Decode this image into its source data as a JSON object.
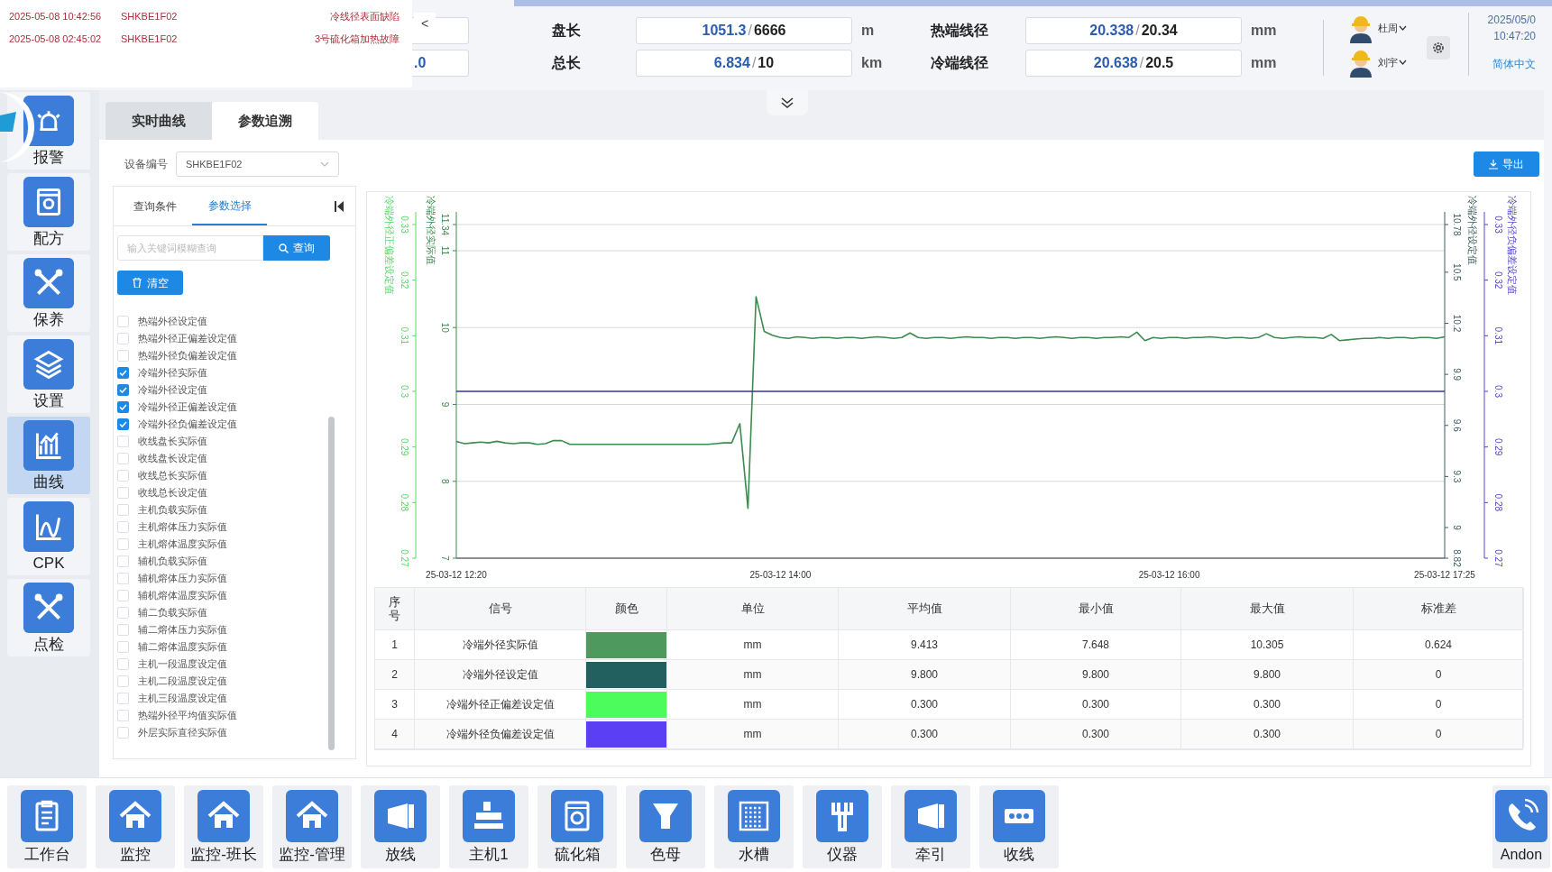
{
  "alerts": [
    {
      "time": "2025-05-08 10:42:56",
      "device": "SHKBE1F02",
      "message": "冷线径表面缺陷"
    },
    {
      "time": "2025-05-08 02:45:02",
      "device": "SHKBE1F02",
      "message": "3号硫化箱加热故障"
    }
  ],
  "alert_collapse": "<",
  "cut_field": {
    "value": ".0"
  },
  "metrics": [
    {
      "label": "盘长",
      "actual": "1051.3",
      "target": "6666",
      "unit": "m",
      "separator": "/"
    },
    {
      "label": "热端线径",
      "actual": "20.338",
      "target": "20.34",
      "unit": "mm",
      "separator": "/"
    },
    {
      "label": "总长",
      "actual": "6.834",
      "target": "10",
      "unit": "km",
      "separator": "/"
    },
    {
      "label": "冷端线径",
      "actual": "20.638",
      "target": "20.5",
      "unit": "mm",
      "separator": "/"
    }
  ],
  "users": [
    {
      "name": "杜周"
    },
    {
      "name": "刘宇"
    }
  ],
  "datetime": {
    "date": "2025/05/0",
    "time": "10:47:20"
  },
  "language": "简体中文",
  "sidebar": {
    "items": [
      {
        "label": "报警",
        "selected": false
      },
      {
        "label": "配方",
        "selected": false
      },
      {
        "label": "保养",
        "selected": false
      },
      {
        "label": "设置",
        "selected": false
      },
      {
        "label": "曲线",
        "selected": true
      },
      {
        "label": "CPK",
        "selected": false
      },
      {
        "label": "点检",
        "selected": false
      }
    ]
  },
  "tabs": [
    {
      "label": "实时曲线",
      "selected": false
    },
    {
      "label": "参数追溯",
      "selected": true
    }
  ],
  "device": {
    "label": "设备编号",
    "value": "SHKBE1F02"
  },
  "export_button": "导出",
  "filter": {
    "tabs": [
      {
        "label": "查询条件",
        "selected": false
      },
      {
        "label": "参数选择",
        "selected": true
      }
    ],
    "search": {
      "placeholder": "输入关键词模糊查询",
      "button": "查询"
    },
    "clear_button": "清空",
    "params": [
      {
        "label": "热端外径设定值",
        "checked": false
      },
      {
        "label": "热端外径正偏差设定值",
        "checked": false
      },
      {
        "label": "热端外径负偏差设定值",
        "checked": false
      },
      {
        "label": "冷端外径实际值",
        "checked": true
      },
      {
        "label": "冷端外径设定值",
        "checked": true
      },
      {
        "label": "冷端外径正偏差设定值",
        "checked": true
      },
      {
        "label": "冷端外径负偏差设定值",
        "checked": true
      },
      {
        "label": "收线盘长实际值",
        "checked": false
      },
      {
        "label": "收线盘长设定值",
        "checked": false
      },
      {
        "label": "收线总长实际值",
        "checked": false
      },
      {
        "label": "收线总长设定值",
        "checked": false
      },
      {
        "label": "主机负载实际值",
        "checked": false
      },
      {
        "label": "主机熔体压力实际值",
        "checked": false
      },
      {
        "label": "主机熔体温度实际值",
        "checked": false
      },
      {
        "label": "辅机负载实际值",
        "checked": false
      },
      {
        "label": "辅机熔体压力实际值",
        "checked": false
      },
      {
        "label": "辅机熔体温度实际值",
        "checked": false
      },
      {
        "label": "辅二负载实际值",
        "checked": false
      },
      {
        "label": "辅二熔体压力实际值",
        "checked": false
      },
      {
        "label": "辅二熔体温度实际值",
        "checked": false
      },
      {
        "label": "主机一段温度设定值",
        "checked": false
      },
      {
        "label": "主机二段温度设定值",
        "checked": false
      },
      {
        "label": "主机三段温度设定值",
        "checked": false
      },
      {
        "label": "热端外径平均值实际值",
        "checked": false
      },
      {
        "label": "外层实际直径实际值",
        "checked": false
      }
    ]
  },
  "chart": {
    "extra_axes": [
      {
        "title": "冷端外径正偏差设定值",
        "ticks": [
          "0.27",
          "0.28",
          "0.29",
          "0.3",
          "0.31",
          "0.32",
          "0.33"
        ]
      }
    ],
    "chart_data": {
      "type": "line",
      "grid": true,
      "ylabel": "冷端外径实际值",
      "ylim": [
        7,
        11.34
      ],
      "yticks": [
        {
          "value": 7,
          "label": "7"
        },
        {
          "value": 8,
          "label": "8"
        },
        {
          "value": 9,
          "label": "9"
        },
        {
          "value": 10,
          "label": "10"
        },
        {
          "value": 11,
          "label": "11"
        },
        {
          "value": 11.34,
          "label": "11.34"
        }
      ],
      "y2label": "冷端外径设定值",
      "y2lim": [
        8.82,
        10.78
      ],
      "y2ticks": [
        {
          "value": 8.82,
          "label": "8.82"
        },
        {
          "value": 9,
          "label": "9"
        },
        {
          "value": 9.3,
          "label": "9.3"
        },
        {
          "value": 9.6,
          "label": "9.6"
        },
        {
          "value": 9.9,
          "label": "9.9"
        },
        {
          "value": 10.2,
          "label": "10.2"
        },
        {
          "value": 10.5,
          "label": "10.5"
        },
        {
          "value": 10.78,
          "label": "10.78"
        }
      ],
      "y3label": "冷端外径负偏差设定值",
      "y3lim": [
        0.27,
        0.33
      ],
      "y3ticks": [
        {
          "value": 0.27,
          "label": "0.27"
        },
        {
          "value": 0.28,
          "label": "0.28"
        },
        {
          "value": 0.29,
          "label": "0.29"
        },
        {
          "value": 0.3,
          "label": "0.3"
        },
        {
          "value": 0.31,
          "label": "0.31"
        },
        {
          "value": 0.32,
          "label": "0.32"
        },
        {
          "value": 0.33,
          "label": "0.33"
        }
      ],
      "categories": [
        "25-03-12 12:20",
        null,
        null,
        null,
        null,
        null,
        null,
        null,
        null,
        null,
        null,
        null,
        null,
        null,
        null,
        null,
        null,
        null,
        null,
        null,
        null,
        null,
        null,
        null,
        null,
        null,
        null,
        null,
        null,
        null,
        null,
        null,
        null,
        null,
        null,
        null,
        null,
        null,
        null,
        null,
        "25-03-12 14:00",
        null,
        null,
        null,
        null,
        null,
        null,
        null,
        null,
        null,
        null,
        null,
        null,
        null,
        null,
        null,
        null,
        null,
        null,
        null,
        null,
        null,
        null,
        null,
        null,
        null,
        null,
        null,
        null,
        null,
        null,
        null,
        null,
        null,
        null,
        null,
        null,
        null,
        null,
        null,
        null,
        null,
        null,
        null,
        null,
        null,
        null,
        null,
        "25-03-12 16:00",
        null,
        null,
        null,
        null,
        null,
        null,
        null,
        null,
        null,
        null,
        null,
        null,
        null,
        null,
        null,
        null,
        null,
        null,
        null,
        null,
        null,
        null,
        null,
        null,
        null,
        null,
        null,
        null,
        null,
        null,
        null,
        null,
        null,
        "25-03-12 17:25"
      ],
      "series": [
        {
          "color": "#3d8b4f",
          "values": [
            8.52,
            8.49,
            8.5,
            8.51,
            8.5,
            8.52,
            8.5,
            8.49,
            8.5,
            8.5,
            8.48,
            8.49,
            8.53,
            8.53,
            8.48,
            8.48,
            8.48,
            8.48,
            8.48,
            8.48,
            8.48,
            8.48,
            8.48,
            8.48,
            8.48,
            8.48,
            8.48,
            8.48,
            8.48,
            8.48,
            8.48,
            8.48,
            8.49,
            8.5,
            8.5,
            8.75,
            7.65,
            10.4,
            9.95,
            9.9,
            9.87,
            9.86,
            9.88,
            9.87,
            9.86,
            9.87,
            9.87,
            9.86,
            9.87,
            9.87,
            9.86,
            9.87,
            9.88,
            9.87,
            9.86,
            9.87,
            9.93,
            9.87,
            9.86,
            9.87,
            9.87,
            9.86,
            9.87,
            9.88,
            9.87,
            9.87,
            9.86,
            9.87,
            9.87,
            9.86,
            9.87,
            9.87,
            9.86,
            9.87,
            9.88,
            9.87,
            9.86,
            9.87,
            9.87,
            9.86,
            9.87,
            9.87,
            9.88,
            9.87,
            9.94,
            9.83,
            9.87,
            9.86,
            9.87,
            9.87,
            9.86,
            9.87,
            9.87,
            9.88,
            9.87,
            9.86,
            9.87,
            9.87,
            9.86,
            9.87,
            9.92,
            9.87,
            9.86,
            9.87,
            9.88,
            9.87,
            9.87,
            9.86,
            9.91,
            9.83,
            9.84,
            9.85,
            9.86,
            9.86,
            9.87,
            9.86,
            9.87,
            9.87,
            9.86,
            9.87,
            9.87,
            9.86,
            9.88
          ]
        },
        {
          "color": "#3b30a0",
          "axis": "y3",
          "values": [
            0.3,
            0.3,
            0.3,
            0.3,
            0.3,
            0.3,
            0.3,
            0.3,
            0.3,
            0.3,
            0.3,
            0.3,
            0.3,
            0.3,
            0.3,
            0.3,
            0.3,
            0.3,
            0.3,
            0.3,
            0.3,
            0.3,
            0.3,
            0.3,
            0.3,
            0.3,
            0.3,
            0.3,
            0.3,
            0.3,
            0.3,
            0.3,
            0.3,
            0.3,
            0.3,
            0.3,
            0.3,
            0.3,
            0.3,
            0.3,
            0.3,
            0.3,
            0.3,
            0.3,
            0.3,
            0.3,
            0.3,
            0.3,
            0.3,
            0.3,
            0.3,
            0.3,
            0.3,
            0.3,
            0.3,
            0.3,
            0.3,
            0.3,
            0.3,
            0.3,
            0.3,
            0.3,
            0.3,
            0.3,
            0.3,
            0.3,
            0.3,
            0.3,
            0.3,
            0.3,
            0.3,
            0.3,
            0.3,
            0.3,
            0.3,
            0.3,
            0.3,
            0.3,
            0.3,
            0.3,
            0.3,
            0.3,
            0.3,
            0.3,
            0.3,
            0.3,
            0.3,
            0.3,
            0.3,
            0.3,
            0.3,
            0.3,
            0.3,
            0.3,
            0.3,
            0.3,
            0.3,
            0.3,
            0.3,
            0.3,
            0.3,
            0.3,
            0.3,
            0.3,
            0.3,
            0.3,
            0.3,
            0.3,
            0.3,
            0.3,
            0.3,
            0.3,
            0.3,
            0.3,
            0.3,
            0.3,
            0.3,
            0.3,
            0.3,
            0.3,
            0.3,
            0.3,
            0.3
          ]
        }
      ]
    }
  },
  "table": {
    "columns": [
      "序号",
      "信号",
      "颜色",
      "单位",
      "平均值",
      "最小值",
      "最大值",
      "标准差"
    ],
    "rows": [
      {
        "index": "1",
        "signal": "冷端外径实际值",
        "color": "#4e9a5e",
        "unit": "mm",
        "mean": "9.413",
        "min": "7.648",
        "max": "10.305",
        "std": "0.624"
      },
      {
        "index": "2",
        "signal": "冷端外径设定值",
        "color": "#21605e",
        "unit": "mm",
        "mean": "9.800",
        "min": "9.800",
        "max": "9.800",
        "std": "0"
      },
      {
        "index": "3",
        "signal": "冷端外径正偏差设定值",
        "color": "#4cfc5c",
        "unit": "mm",
        "mean": "0.300",
        "min": "0.300",
        "max": "0.300",
        "std": "0"
      },
      {
        "index": "4",
        "signal": "冷端外径负偏差设定值",
        "color": "#5b3ff5",
        "unit": "mm",
        "mean": "0.300",
        "min": "0.300",
        "max": "0.300",
        "std": "0"
      }
    ]
  },
  "bottom_nav": {
    "items": [
      {
        "label": "工作台"
      },
      {
        "label": "监控"
      },
      {
        "label": "监控-班长"
      },
      {
        "label": "监控-管理"
      },
      {
        "label": "放线"
      },
      {
        "label": "主机1"
      },
      {
        "label": "硫化箱"
      },
      {
        "label": "色母"
      },
      {
        "label": "水槽"
      },
      {
        "label": "仪器"
      },
      {
        "label": "牵引"
      },
      {
        "label": "收线"
      }
    ]
  },
  "andon": {
    "label": "Andon"
  }
}
